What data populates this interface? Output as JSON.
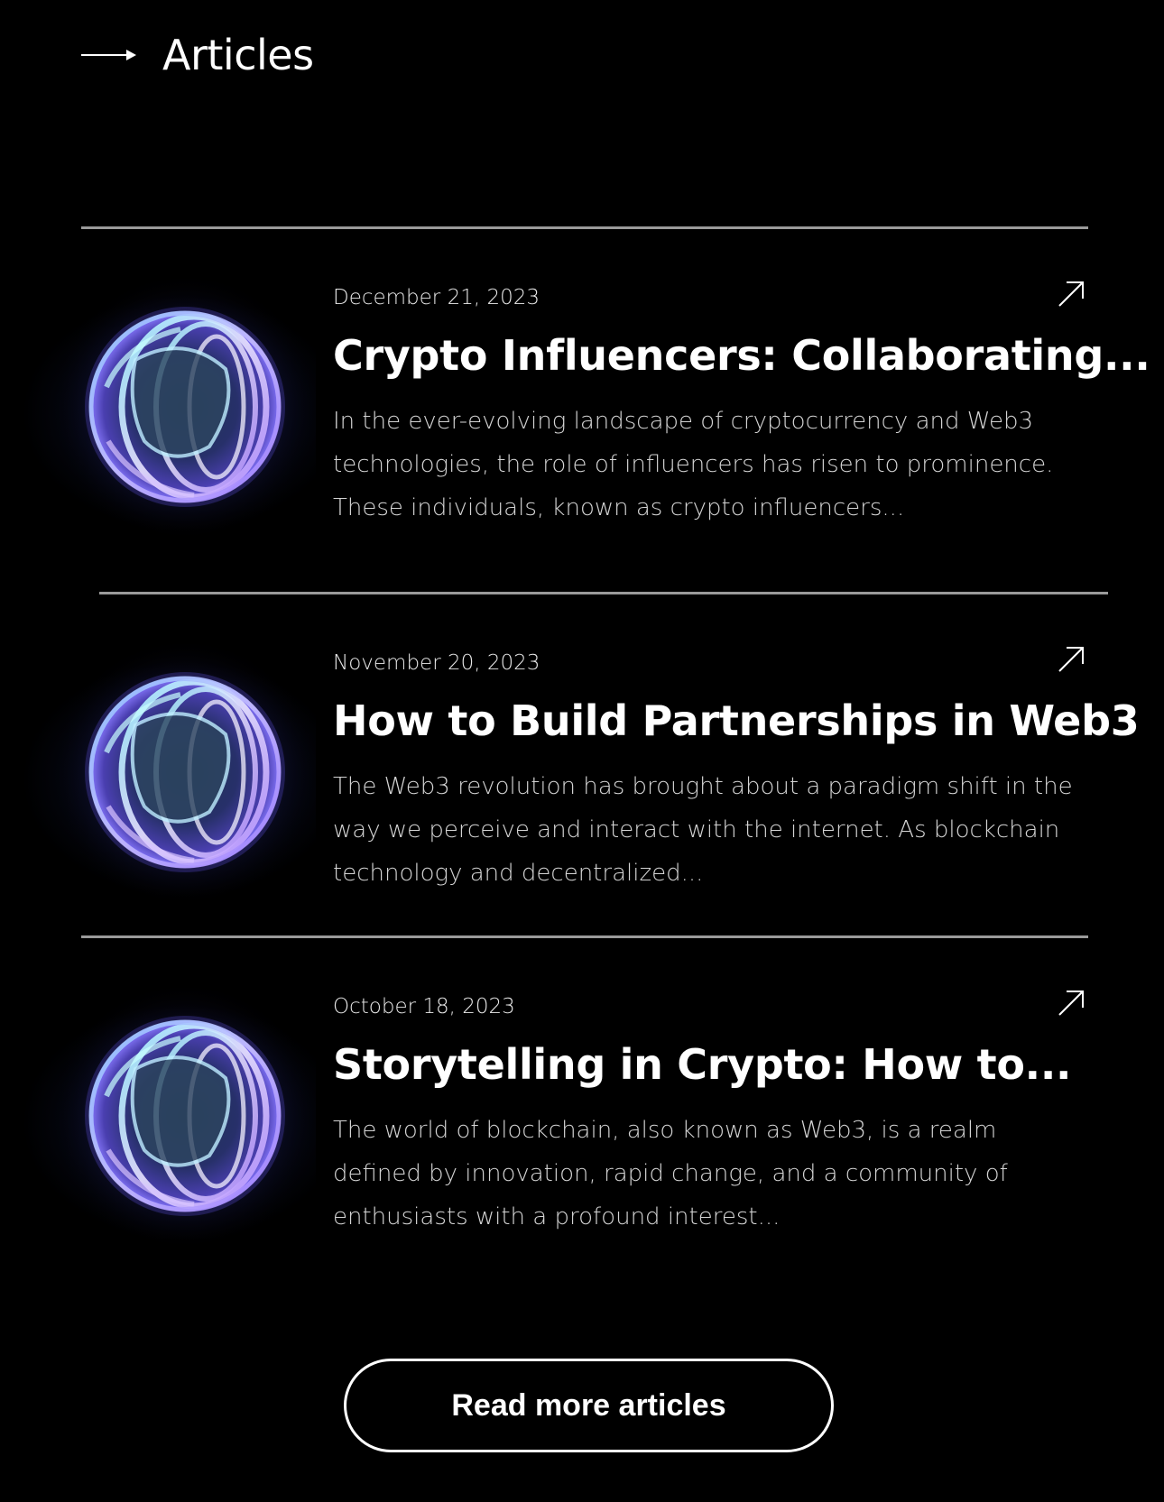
{
  "section": {
    "title": "Articles",
    "icon": "arrow-right-icon"
  },
  "articles": [
    {
      "date": "December 21, 2023",
      "title": "Crypto Influencers: Collaborating...",
      "excerpt": "In the ever-evolving landscape of cryptocurrency and Web3 technologies, the role of influencers has risen to prominence. These individuals, known as crypto influencers...",
      "image": "glass-sphere-image",
      "link_icon": "arrow-up-right-icon"
    },
    {
      "date": "November 20, 2023",
      "title": "How to Build Partnerships in Web3",
      "excerpt": "The Web3 revolution has brought about a paradigm shift in the way we perceive and interact with the internet. As blockchain technology and decentralized...",
      "image": "glass-sphere-image",
      "link_icon": "arrow-up-right-icon"
    },
    {
      "date": "October 18, 2023",
      "title": "Storytelling in Crypto: How to...",
      "excerpt": "The world of blockchain, also known as Web3, is a realm defined by innovation, rapid change, and a community of enthusiasts with a profound interest...",
      "image": "glass-sphere-image",
      "link_icon": "arrow-up-right-icon"
    }
  ],
  "cta": {
    "label": "Read more articles"
  },
  "colors": {
    "background": "#000000",
    "text": "#ffffff",
    "divider": "#9a9a9a",
    "sphere_glow": "#6a5cff"
  }
}
